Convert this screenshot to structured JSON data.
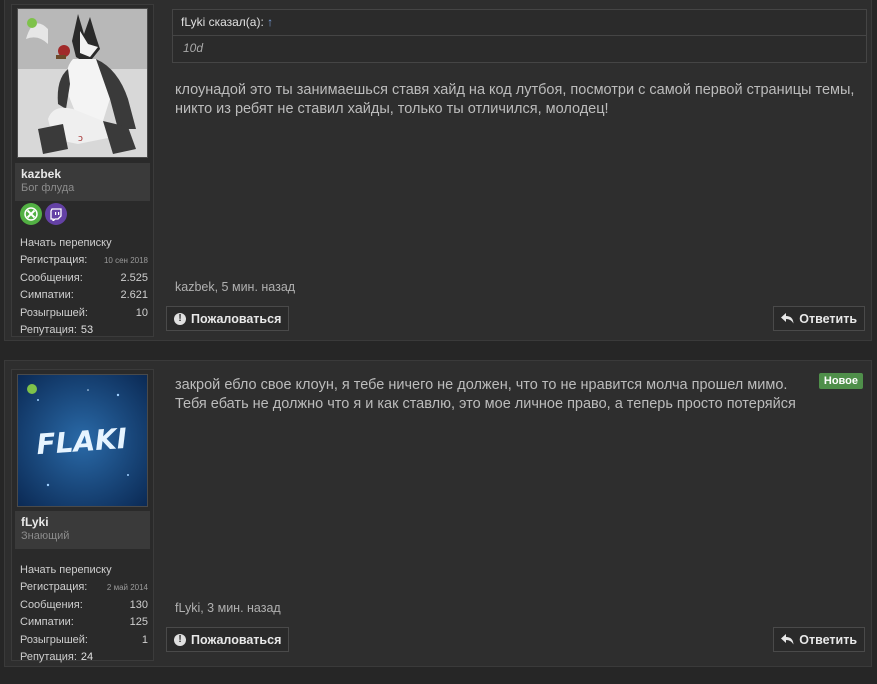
{
  "posts": [
    {
      "user": {
        "name": "kazbek",
        "title": "Бог флуда",
        "start_conversation": "Начать переписку",
        "stats": [
          {
            "label": "Регистрация:",
            "value": "10 сен 2018"
          },
          {
            "label": "Сообщения:",
            "value": "2.525"
          },
          {
            "label": "Симпатии:",
            "value": "2.621"
          },
          {
            "label": "Розыгрышей:",
            "value": "10"
          }
        ],
        "reputation_label": "Репутация:",
        "reputation": "53",
        "badges": [
          "xbox-icon",
          "twitch-icon"
        ],
        "online": true
      },
      "quote": {
        "author": "fLyki сказал(а):",
        "arrow": "↑",
        "text": "10d"
      },
      "message": "клоунадой это ты занимаешься ставя хайд на код лутбоя, посмотри с самой первой страницы темы, никто из ребят не ставил хайды, только ты отличился, молодец!",
      "meta": "kazbek, 5 мин. назад",
      "report_label": "Пожаловаться",
      "reply_label": "Ответить"
    },
    {
      "user": {
        "name": "fLyki",
        "title": "Знающий",
        "start_conversation": "Начать переписку",
        "avatar_text": "FLAKI",
        "stats": [
          {
            "label": "Регистрация:",
            "value": "2 май 2014"
          },
          {
            "label": "Сообщения:",
            "value": "130"
          },
          {
            "label": "Симпатии:",
            "value": "125"
          },
          {
            "label": "Розыгрышей:",
            "value": "1"
          }
        ],
        "reputation_label": "Репутация:",
        "reputation": "24",
        "online": true
      },
      "new_badge": "Новое",
      "message": "закрой ебло свое клоун, я тебе ничего не должен, что то не нравится молча прошел мимо. Тебя ебать не должно что я и как ставлю, это мое личное право, а теперь просто потеряйся",
      "meta": "fLyki, 3 мин. назад",
      "report_label": "Пожаловаться",
      "reply_label": "Ответить"
    }
  ],
  "colors": {
    "online": "#7ec24a",
    "xbox": "#52b043",
    "twitch": "#6441a5",
    "new_badge": "#4f8f4a"
  }
}
